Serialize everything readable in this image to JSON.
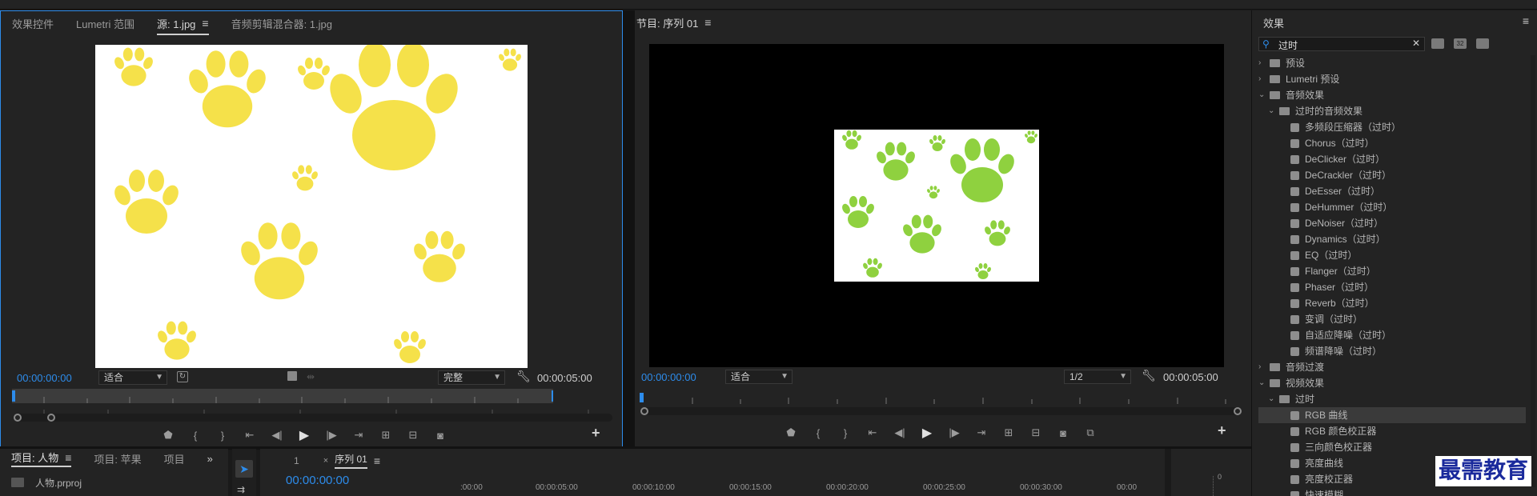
{
  "source_panel": {
    "tabs": [
      "效果控件",
      "Lumetri 范围",
      "源: 1.jpg",
      "音频剪辑混合器: 1.jpg"
    ],
    "active_tab": "源: 1.jpg",
    "timecode_current": "00:00:00:00",
    "timecode_duration": "00:00:05:00",
    "fit_value": "适合",
    "quality_value": "完整"
  },
  "program_panel": {
    "title": "节目: 序列 01",
    "timecode_current": "00:00:00:00",
    "timecode_duration": "00:00:05:00",
    "fit_value": "适合",
    "resolution_value": "1/2"
  },
  "effects_panel": {
    "title": "效果",
    "search_value": "过时",
    "tree": [
      {
        "label": "预设",
        "level": 0,
        "expanded": false,
        "type": "folder"
      },
      {
        "label": "Lumetri 预设",
        "level": 0,
        "expanded": false,
        "type": "folder"
      },
      {
        "label": "音频效果",
        "level": 0,
        "expanded": true,
        "type": "folder"
      },
      {
        "label": "过时的音频效果",
        "level": 1,
        "expanded": true,
        "type": "folder"
      },
      {
        "label": "多频段压缩器（过时）",
        "level": 2,
        "type": "effect"
      },
      {
        "label": "Chorus（过时）",
        "level": 2,
        "type": "effect"
      },
      {
        "label": "DeClicker（过时）",
        "level": 2,
        "type": "effect"
      },
      {
        "label": "DeCrackler（过时）",
        "level": 2,
        "type": "effect"
      },
      {
        "label": "DeEsser（过时）",
        "level": 2,
        "type": "effect"
      },
      {
        "label": "DeHummer（过时）",
        "level": 2,
        "type": "effect"
      },
      {
        "label": "DeNoiser（过时）",
        "level": 2,
        "type": "effect"
      },
      {
        "label": "Dynamics（过时）",
        "level": 2,
        "type": "effect"
      },
      {
        "label": "EQ（过时）",
        "level": 2,
        "type": "effect"
      },
      {
        "label": "Flanger（过时）",
        "level": 2,
        "type": "effect"
      },
      {
        "label": "Phaser（过时）",
        "level": 2,
        "type": "effect"
      },
      {
        "label": "Reverb（过时）",
        "level": 2,
        "type": "effect"
      },
      {
        "label": "变调（过时）",
        "level": 2,
        "type": "effect"
      },
      {
        "label": "自适应降噪（过时）",
        "level": 2,
        "type": "effect"
      },
      {
        "label": "频谱降噪（过时）",
        "level": 2,
        "type": "effect"
      },
      {
        "label": "音频过渡",
        "level": 0,
        "expanded": false,
        "type": "folder"
      },
      {
        "label": "视频效果",
        "level": 0,
        "expanded": true,
        "type": "folder"
      },
      {
        "label": "过时",
        "level": 1,
        "expanded": true,
        "type": "folder"
      },
      {
        "label": "RGB 曲线",
        "level": 2,
        "type": "effect",
        "selected": true
      },
      {
        "label": "RGB 颜色校正器",
        "level": 2,
        "type": "effect"
      },
      {
        "label": "三向颜色校正器",
        "level": 2,
        "type": "effect"
      },
      {
        "label": "亮度曲线",
        "level": 2,
        "type": "effect"
      },
      {
        "label": "亮度校正器",
        "level": 2,
        "type": "effect"
      },
      {
        "label": "快速模糊",
        "level": 2,
        "type": "effect"
      }
    ]
  },
  "project_panel": {
    "tabs": [
      "项目: 人物",
      "项目: 苹果",
      "项目"
    ],
    "file": "人物.prproj"
  },
  "timeline_panel": {
    "tabs": [
      "1",
      "序列 01"
    ],
    "timecode": "00:00:00:00",
    "ruler_labels": [
      ":00:00",
      "00:00:05:00",
      "00:00:10:00",
      "00:00:15:00",
      "00:00:20:00",
      "00:00:25:00",
      "00:00:30:00",
      "00:00"
    ],
    "meter_value": "0"
  },
  "watermark": "最需教育",
  "colors": {
    "accent": "#2d8ceb",
    "paw_source": "#f5e14a",
    "paw_program": "#8fd13f"
  }
}
